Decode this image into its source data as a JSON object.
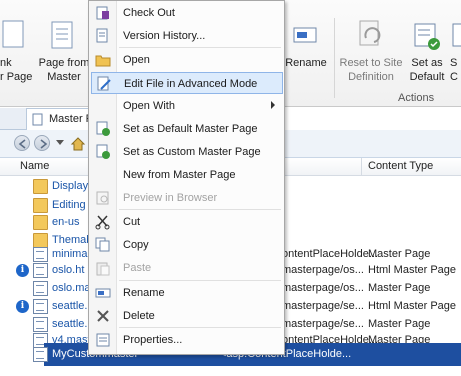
{
  "ribbon": {
    "items": [
      {
        "line1": "nk",
        "line2": "r Page"
      },
      {
        "line1": "Page from",
        "line2": "Master"
      },
      {
        "line1": "Rename",
        "line2": ""
      },
      {
        "line1": "Reset to Site",
        "line2": "Definition"
      },
      {
        "line1": "Set as",
        "line2": "Default"
      },
      {
        "line1": "S",
        "line2": "C"
      }
    ],
    "group_label": "Actions"
  },
  "tab": {
    "label": "Master Pages"
  },
  "columns": {
    "name": "Name",
    "type": "Content Type"
  },
  "rows": [
    {
      "name": "Display",
      "title": "",
      "type": "",
      "icon": "folder",
      "info": false
    },
    {
      "name": "Editing",
      "title": "",
      "type": "",
      "icon": "folder",
      "info": false
    },
    {
      "name": "en-us",
      "title": "",
      "type": "",
      "icon": "folder",
      "info": false
    },
    {
      "name": "Themab",
      "title": "",
      "type": "",
      "icon": "folder",
      "info": false
    },
    {
      "name": "minima",
      "title": "ontentPlaceHolde...",
      "type": "Master Page",
      "icon": "page",
      "info": false
    },
    {
      "name": "oslo.ht",
      "title": "masterpage/os...",
      "type": "Html Master Page",
      "icon": "page",
      "info": true
    },
    {
      "name": "oslo.ma",
      "title": "masterpage/os...",
      "type": "Master Page",
      "icon": "page",
      "info": false
    },
    {
      "name": "seattle.",
      "title": "masterpage/se...",
      "type": "Html Master Page",
      "icon": "page",
      "info": true
    },
    {
      "name": "seattle.",
      "title": "masterpage/se...",
      "type": "Master Page",
      "icon": "page",
      "info": false
    },
    {
      "name": "v4.mast",
      "title": "ontentPlaceHolde...",
      "type": "Master Page",
      "icon": "page",
      "info": false
    },
    {
      "name": "MyCustommaster",
      "title": "<asp:ContentPlaceHolde...",
      "type": "",
      "icon": "page",
      "info": false
    }
  ],
  "menu": {
    "items": [
      {
        "label": "Check Out",
        "icon": "check-out-icon",
        "disabled": false,
        "submenu": false
      },
      {
        "label": "Version History...",
        "icon": "version-history-icon",
        "disabled": false,
        "submenu": false
      },
      {
        "label": "Open",
        "icon": "open-folder-icon",
        "disabled": false,
        "submenu": false
      },
      {
        "label": "Edit File in Advanced Mode",
        "icon": "edit-file-icon",
        "disabled": false,
        "submenu": false,
        "highlight": true
      },
      {
        "label": "Open With",
        "icon": "",
        "disabled": false,
        "submenu": true
      },
      {
        "label": "Set as Default Master Page",
        "icon": "default-master-icon",
        "disabled": false,
        "submenu": false
      },
      {
        "label": "Set as Custom Master Page",
        "icon": "custom-master-icon",
        "disabled": false,
        "submenu": false
      },
      {
        "label": "New from Master Page",
        "icon": "",
        "disabled": false,
        "submenu": false
      },
      {
        "label": "Preview in Browser",
        "icon": "preview-icon",
        "disabled": true,
        "submenu": false
      },
      {
        "label": "Cut",
        "icon": "scissors-icon",
        "disabled": false,
        "submenu": false
      },
      {
        "label": "Copy",
        "icon": "copy-icon",
        "disabled": false,
        "submenu": false
      },
      {
        "label": "Paste",
        "icon": "paste-icon",
        "disabled": true,
        "submenu": false
      },
      {
        "label": "Rename",
        "icon": "rename-icon",
        "disabled": false,
        "submenu": false
      },
      {
        "label": "Delete",
        "icon": "delete-icon",
        "disabled": false,
        "submenu": false
      },
      {
        "label": "Properties...",
        "icon": "properties-icon",
        "disabled": false,
        "submenu": false
      }
    ]
  },
  "colors": {
    "selection": "#1e4fa0",
    "highlight": "#dcebfc",
    "link": "#1a55a8"
  }
}
